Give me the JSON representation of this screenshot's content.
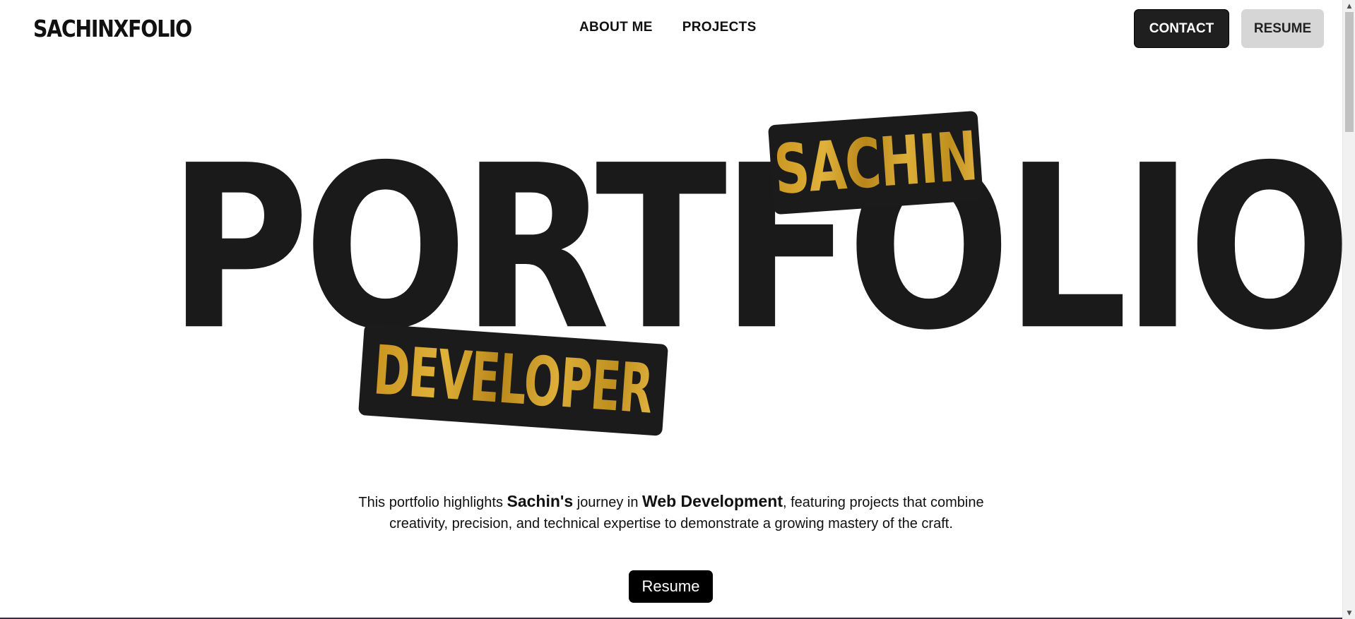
{
  "header": {
    "logo": "SACHINXFOLIO",
    "nav": [
      {
        "label": "ABOUT ME"
      },
      {
        "label": "PROJECTS"
      }
    ],
    "contact_label": "CONTACT",
    "resume_label": "RESUME"
  },
  "hero": {
    "word": "PORTFOLIO",
    "tag_top": "SACHIN",
    "tag_bottom": "DEVELOPER",
    "accent_color": "#d4a22a",
    "word_color": "#1a1a1a"
  },
  "intro": {
    "part1": "This portfolio highlights ",
    "name": "Sachin's",
    "part2": " journey in ",
    "field": "Web Development",
    "part3": ", featuring projects that combine creativity, precision, and technical expertise to demonstrate a growing mastery of the craft.",
    "button_label": "Resume"
  },
  "scrollbar": {
    "up_icon": "▲",
    "down_icon": "▼"
  }
}
